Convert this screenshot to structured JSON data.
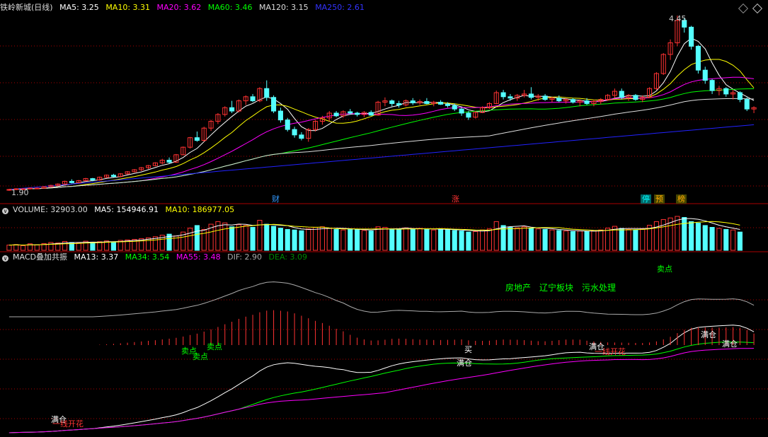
{
  "main_header": {
    "title": "铁岭新城(日线)",
    "ma": [
      {
        "text": "MA5: 3.25",
        "color": "#ffffff"
      },
      {
        "text": "MA10: 3.31",
        "color": "#ffff00"
      },
      {
        "text": "MA20: 3.62",
        "color": "#ff00ff"
      },
      {
        "text": "MA60: 3.46",
        "color": "#00ff00"
      },
      {
        "text": "MA120: 3.15",
        "color": "#dddddd"
      },
      {
        "text": "MA250: 2.61",
        "color": "#0000ff"
      }
    ]
  },
  "volume_header": {
    "label": "VOLUME: 32903.00",
    "ma5": "MA5: 154946.91",
    "ma10": "MA10: 186977.05"
  },
  "macd_header": {
    "label": "MACD叠加共振",
    "items": [
      {
        "text": "MA13: 3.37",
        "color": "#ffffff"
      },
      {
        "text": "MA34: 3.54",
        "color": "#00ff00"
      },
      {
        "text": "MA55: 3.48",
        "color": "#ff00ff"
      },
      {
        "text": "DIF: 2.90",
        "color": "#aaaaaa"
      },
      {
        "text": "DEA: 3.09",
        "color": "#00aa00"
      }
    ]
  },
  "price_markers": {
    "high": "4.45",
    "low": "1.90"
  },
  "events": [
    {
      "text": "财",
      "bg": "#000000",
      "color": "#3399ff"
    },
    {
      "text": "涨",
      "bg": "#000000",
      "color": "#ff3333"
    },
    {
      "text": "停",
      "bg": "#006666",
      "color": "#00ffff"
    },
    {
      "text": "预",
      "bg": "#444400",
      "color": "#ffaa00"
    },
    {
      "text": "榜",
      "bg": "#444400",
      "color": "#ffaa00"
    }
  ],
  "sector_tags": [
    "房地产",
    "辽宁板块",
    "污水处理"
  ],
  "signals": [
    {
      "text": "卖点",
      "color": "#00ff00"
    },
    {
      "text": "卖点",
      "color": "#00ff00"
    },
    {
      "text": "卖点",
      "color": "#00ff00"
    },
    {
      "text": "卖点",
      "color": "#00ff00"
    },
    {
      "text": "满仓",
      "color": "#ffffff"
    },
    {
      "text": "满仓",
      "color": "#ffffff"
    },
    {
      "text": "满仓",
      "color": "#ffffff"
    },
    {
      "text": "满仓",
      "color": "#ffffff"
    },
    {
      "text": "满仓",
      "color": "#ffffff"
    },
    {
      "text": "一线开花",
      "color": "#ff3333"
    },
    {
      "text": "一线开花",
      "color": "#ff3333"
    },
    {
      "text": "买",
      "color": "#ffffff"
    }
  ],
  "colors": {
    "up": "#ff3232",
    "down": "#54ffff",
    "grid": "#aa0000",
    "bg": "#000000"
  },
  "chart_data": {
    "type": "candlestick",
    "price_range": [
      1.9,
      4.45
    ],
    "ohlc": [
      [
        1.9,
        1.91,
        1.88,
        1.9
      ],
      [
        1.9,
        1.92,
        1.89,
        1.91
      ],
      [
        1.91,
        1.92,
        1.9,
        1.91
      ],
      [
        1.91,
        1.93,
        1.9,
        1.92
      ],
      [
        1.92,
        1.93,
        1.91,
        1.92
      ],
      [
        1.92,
        1.95,
        1.91,
        1.94
      ],
      [
        1.94,
        1.97,
        1.93,
        1.96
      ],
      [
        1.96,
        1.99,
        1.95,
        1.98
      ],
      [
        1.98,
        2.03,
        1.97,
        2.02
      ],
      [
        2.02,
        2.05,
        1.99,
        2.0
      ],
      [
        2.0,
        2.04,
        1.99,
        2.03
      ],
      [
        2.03,
        2.07,
        2.02,
        2.06
      ],
      [
        2.06,
        2.07,
        2.02,
        2.04
      ],
      [
        2.04,
        2.09,
        2.03,
        2.08
      ],
      [
        2.08,
        2.12,
        2.07,
        2.11
      ],
      [
        2.11,
        2.13,
        2.08,
        2.09
      ],
      [
        2.09,
        2.14,
        2.08,
        2.13
      ],
      [
        2.13,
        2.17,
        2.12,
        2.16
      ],
      [
        2.16,
        2.2,
        2.15,
        2.19
      ],
      [
        2.19,
        2.23,
        2.17,
        2.22
      ],
      [
        2.22,
        2.26,
        2.2,
        2.25
      ],
      [
        2.25,
        2.3,
        2.24,
        2.29
      ],
      [
        2.29,
        2.35,
        2.27,
        2.33
      ],
      [
        2.33,
        2.37,
        2.28,
        2.3
      ],
      [
        2.3,
        2.42,
        2.29,
        2.41
      ],
      [
        2.41,
        2.53,
        2.4,
        2.52
      ],
      [
        2.52,
        2.67,
        2.5,
        2.66
      ],
      [
        2.66,
        2.75,
        2.6,
        2.62
      ],
      [
        2.62,
        2.82,
        2.6,
        2.8
      ],
      [
        2.8,
        2.92,
        2.76,
        2.9
      ],
      [
        2.9,
        3.02,
        2.86,
        3.0
      ],
      [
        3.0,
        3.12,
        2.97,
        3.1
      ],
      [
        3.1,
        3.2,
        3.02,
        3.05
      ],
      [
        3.05,
        3.22,
        3.03,
        3.2
      ],
      [
        3.2,
        3.28,
        3.14,
        3.26
      ],
      [
        3.26,
        3.3,
        3.18,
        3.2
      ],
      [
        3.2,
        3.4,
        3.18,
        3.38
      ],
      [
        3.38,
        3.5,
        3.2,
        3.25
      ],
      [
        3.25,
        3.28,
        3.02,
        3.05
      ],
      [
        3.05,
        3.1,
        2.88,
        2.92
      ],
      [
        2.92,
        2.95,
        2.75,
        2.78
      ],
      [
        2.78,
        2.82,
        2.66,
        2.7
      ],
      [
        2.7,
        2.74,
        2.62,
        2.65
      ],
      [
        2.65,
        2.8,
        2.6,
        2.78
      ],
      [
        2.78,
        2.92,
        2.75,
        2.9
      ],
      [
        2.9,
        2.98,
        2.85,
        2.95
      ],
      [
        2.95,
        3.05,
        2.9,
        3.02
      ],
      [
        3.02,
        3.05,
        2.96,
        2.98
      ],
      [
        2.98,
        3.06,
        2.95,
        3.04
      ],
      [
        3.04,
        3.08,
        3.0,
        3.02
      ],
      [
        3.02,
        3.04,
        2.97,
        3.0
      ],
      [
        3.0,
        3.05,
        2.96,
        3.03
      ],
      [
        3.03,
        3.06,
        2.98,
        2.99
      ],
      [
        2.99,
        3.2,
        2.98,
        3.18
      ],
      [
        3.18,
        3.25,
        3.12,
        3.2
      ],
      [
        3.2,
        3.22,
        3.12,
        3.16
      ],
      [
        3.16,
        3.2,
        3.1,
        3.14
      ],
      [
        3.14,
        3.22,
        3.12,
        3.2
      ],
      [
        3.2,
        3.24,
        3.14,
        3.17
      ],
      [
        3.17,
        3.22,
        3.14,
        3.19
      ],
      [
        3.19,
        3.24,
        3.15,
        3.16
      ],
      [
        3.16,
        3.2,
        3.12,
        3.18
      ],
      [
        3.18,
        3.21,
        3.14,
        3.15
      ],
      [
        3.15,
        3.18,
        3.1,
        3.13
      ],
      [
        3.13,
        3.16,
        3.05,
        3.08
      ],
      [
        3.08,
        3.1,
        2.98,
        3.02
      ],
      [
        3.02,
        3.05,
        2.92,
        2.96
      ],
      [
        2.96,
        3.05,
        2.94,
        3.03
      ],
      [
        3.03,
        3.12,
        3.02,
        3.1
      ],
      [
        3.1,
        3.18,
        3.08,
        3.16
      ],
      [
        3.16,
        3.35,
        3.15,
        3.32
      ],
      [
        3.32,
        3.36,
        3.22,
        3.26
      ],
      [
        3.26,
        3.3,
        3.2,
        3.24
      ],
      [
        3.24,
        3.3,
        3.2,
        3.28
      ],
      [
        3.28,
        3.36,
        3.25,
        3.3
      ],
      [
        3.3,
        3.4,
        3.22,
        3.25
      ],
      [
        3.25,
        3.3,
        3.2,
        3.27
      ],
      [
        3.27,
        3.3,
        3.2,
        3.22
      ],
      [
        3.22,
        3.26,
        3.18,
        3.24
      ],
      [
        3.24,
        3.28,
        3.18,
        3.2
      ],
      [
        3.2,
        3.24,
        3.16,
        3.22
      ],
      [
        3.22,
        3.24,
        3.16,
        3.18
      ],
      [
        3.18,
        3.22,
        3.12,
        3.2
      ],
      [
        3.2,
        3.24,
        3.14,
        3.16
      ],
      [
        3.16,
        3.22,
        3.12,
        3.19
      ],
      [
        3.19,
        3.24,
        3.15,
        3.22
      ],
      [
        3.22,
        3.3,
        3.2,
        3.28
      ],
      [
        3.28,
        3.38,
        3.24,
        3.34
      ],
      [
        3.34,
        3.38,
        3.22,
        3.25
      ],
      [
        3.25,
        3.3,
        3.2,
        3.28
      ],
      [
        3.28,
        3.3,
        3.2,
        3.22
      ],
      [
        3.22,
        3.28,
        3.18,
        3.25
      ],
      [
        3.25,
        3.4,
        3.24,
        3.38
      ],
      [
        3.38,
        3.62,
        3.36,
        3.6
      ],
      [
        3.6,
        3.9,
        3.58,
        3.88
      ],
      [
        3.88,
        4.1,
        3.8,
        4.05
      ],
      [
        4.05,
        4.45,
        4.0,
        4.38
      ],
      [
        4.38,
        4.42,
        4.2,
        4.28
      ],
      [
        4.28,
        4.3,
        3.95,
        4.0
      ],
      [
        4.0,
        4.02,
        3.6,
        3.65
      ],
      [
        3.65,
        3.7,
        3.45,
        3.5
      ],
      [
        3.5,
        3.52,
        3.3,
        3.35
      ],
      [
        3.35,
        3.42,
        3.28,
        3.38
      ],
      [
        3.38,
        3.4,
        3.26,
        3.3
      ],
      [
        3.3,
        3.36,
        3.22,
        3.32
      ],
      [
        3.32,
        3.34,
        3.18,
        3.22
      ],
      [
        3.22,
        3.25,
        3.05,
        3.08
      ],
      [
        3.08,
        3.12,
        3.02,
        3.1
      ]
    ],
    "volume": [
      20,
      22,
      18,
      25,
      21,
      26,
      30,
      28,
      34,
      30,
      28,
      35,
      30,
      33,
      36,
      32,
      38,
      40,
      42,
      45,
      48,
      52,
      58,
      62,
      55,
      70,
      85,
      95,
      80,
      100,
      110,
      105,
      90,
      98,
      95,
      88,
      115,
      100,
      92,
      85,
      80,
      78,
      75,
      82,
      88,
      90,
      85,
      80,
      78,
      82,
      80,
      76,
      74,
      90,
      88,
      82,
      80,
      86,
      82,
      84,
      80,
      78,
      82,
      80,
      76,
      74,
      70,
      72,
      78,
      82,
      110,
      95,
      88,
      86,
      90,
      84,
      82,
      80,
      78,
      76,
      74,
      72,
      74,
      72,
      75,
      78,
      85,
      92,
      84,
      80,
      78,
      82,
      96,
      110,
      118,
      124,
      130,
      126,
      110,
      104,
      95,
      88,
      84,
      80,
      78,
      70
    ]
  }
}
